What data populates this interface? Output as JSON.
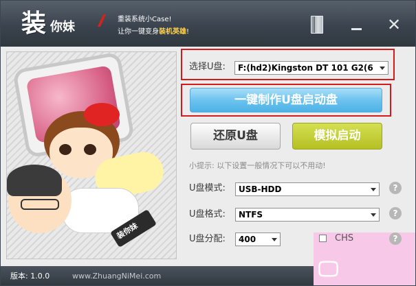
{
  "window": {
    "logo_main": "装",
    "logo_sub": "你妹",
    "slogan_line1": "重装系统小Case!",
    "slogan_line2_prefix": "让你一键变身",
    "slogan_line2_highlight": "装机英雄",
    "slogan_line2_suffix": "!"
  },
  "illustration": {
    "usb_text": "装你妹"
  },
  "select_usb": {
    "label": "选择U盘:",
    "value": "F:(hd2)Kingston DT 101 G2(6"
  },
  "buttons": {
    "make_boot": "一键制作U盘启动盘",
    "restore": "还原U盘",
    "simulate": "模拟启动"
  },
  "tip": "小提示: 以下设置一般情况下可以不用动!",
  "settings": {
    "mode_label": "U盘模式:",
    "mode_value": "USB-HDD",
    "format_label": "U盘格式:",
    "format_value": "NTFS",
    "alloc_label": "U盘分配:",
    "alloc_value": "400",
    "chs_label": "CHS",
    "help_glyph": "?"
  },
  "footer": {
    "version": "版本: 1.0.0",
    "site": "www.ZhuangNiMei.com"
  },
  "colors": {
    "header": "#3b444e",
    "highlight_box": "#d4191d",
    "primary_button": "#6cc3ef",
    "simulate_button": "#b5c024"
  },
  "icons": [
    "book-icon",
    "minimize-icon",
    "close-icon",
    "help-icon",
    "dropdown-arrow-icon"
  ]
}
